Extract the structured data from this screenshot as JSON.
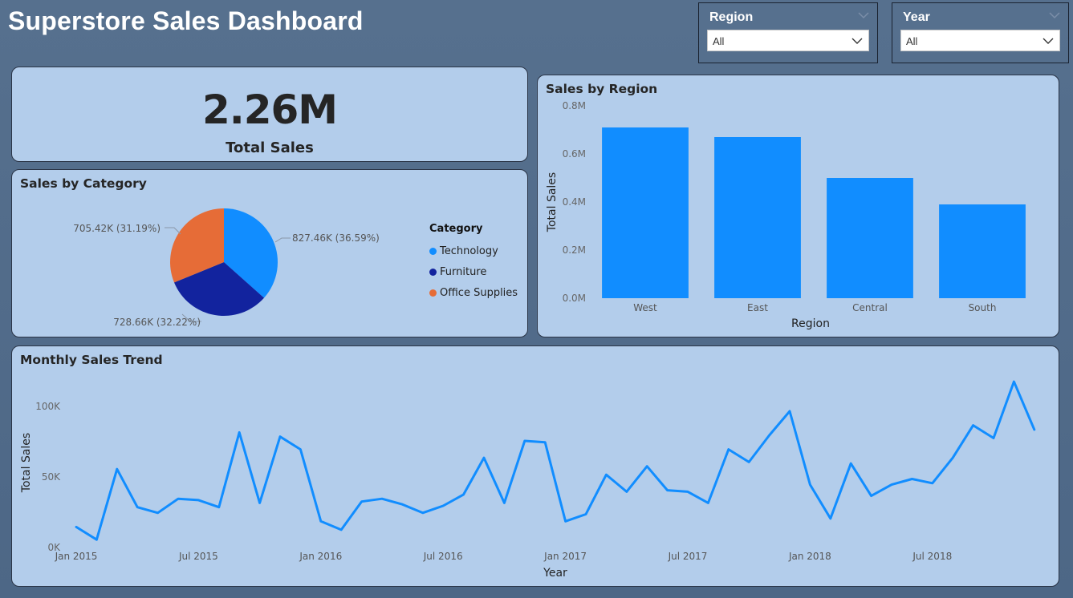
{
  "dashboard": {
    "title": "Superstore Sales Dashboard"
  },
  "slicers": {
    "region": {
      "label": "Region",
      "value": "All"
    },
    "year": {
      "label": "Year",
      "value": "All"
    }
  },
  "kpi": {
    "value": "2.26M",
    "label": "Total Sales"
  },
  "category_card": {
    "title": "Sales by Category",
    "legend_title": "Category",
    "legend": [
      {
        "label": "Technology",
        "color": "#118dff"
      },
      {
        "label": "Furniture",
        "color": "#12239e"
      },
      {
        "label": "Office Supplies",
        "color": "#e66c37"
      }
    ],
    "slice_labels": [
      "827.46K (36.59%)",
      "728.66K (32.22%)",
      "705.42K (31.19%)"
    ]
  },
  "region_card": {
    "title": "Sales by Region"
  },
  "trend_card": {
    "title": "Monthly Sales Trend"
  },
  "chart_data": [
    {
      "type": "pie",
      "title": "Sales by Category",
      "legend_title": "Category",
      "categories": [
        "Technology",
        "Furniture",
        "Office Supplies"
      ],
      "values": [
        827460,
        728660,
        705420
      ],
      "colors": [
        "#118dff",
        "#12239e",
        "#e66c37"
      ]
    },
    {
      "type": "bar",
      "title": "Sales by Region",
      "xlabel": "Region",
      "ylabel": "Total Sales",
      "categories": [
        "West",
        "East",
        "Central",
        "South"
      ],
      "values": [
        710000,
        670000,
        500000,
        390000
      ],
      "ylim": [
        0,
        800000
      ],
      "yticks": [
        "0.0M",
        "0.2M",
        "0.4M",
        "0.6M",
        "0.8M"
      ],
      "color": "#118dff"
    },
    {
      "type": "line",
      "title": "Monthly Sales Trend",
      "xlabel": "Year",
      "ylabel": "Total Sales",
      "x": [
        "2015-01",
        "2015-02",
        "2015-03",
        "2015-04",
        "2015-05",
        "2015-06",
        "2015-07",
        "2015-08",
        "2015-09",
        "2015-10",
        "2015-11",
        "2015-12",
        "2016-01",
        "2016-02",
        "2016-03",
        "2016-04",
        "2016-05",
        "2016-06",
        "2016-07",
        "2016-08",
        "2016-09",
        "2016-10",
        "2016-11",
        "2016-12",
        "2017-01",
        "2017-02",
        "2017-03",
        "2017-04",
        "2017-05",
        "2017-06",
        "2017-07",
        "2017-08",
        "2017-09",
        "2017-10",
        "2017-11",
        "2017-12",
        "2018-01",
        "2018-02",
        "2018-03",
        "2018-04",
        "2018-05",
        "2018-06",
        "2018-07",
        "2018-08",
        "2018-09",
        "2018-10",
        "2018-11",
        "2018-12"
      ],
      "values": [
        14000,
        5000,
        55000,
        28000,
        24000,
        34000,
        33000,
        28000,
        81000,
        31000,
        78000,
        69000,
        18000,
        12000,
        32000,
        34000,
        30000,
        24000,
        29000,
        37000,
        63000,
        31000,
        75000,
        74000,
        18000,
        23000,
        51000,
        39000,
        57000,
        40000,
        39000,
        31000,
        69000,
        60000,
        79000,
        96000,
        44000,
        20000,
        59000,
        36000,
        44000,
        48000,
        45000,
        63000,
        86000,
        77000,
        117000,
        83000
      ],
      "xticks": [
        "Jan 2015",
        "Jul 2015",
        "Jan 2016",
        "Jul 2016",
        "Jan 2017",
        "Jul 2017",
        "Jan 2018",
        "Jul 2018"
      ],
      "yticks": [
        "0K",
        "50K",
        "100K"
      ],
      "ylim": [
        0,
        100000
      ],
      "color": "#118dff"
    }
  ]
}
